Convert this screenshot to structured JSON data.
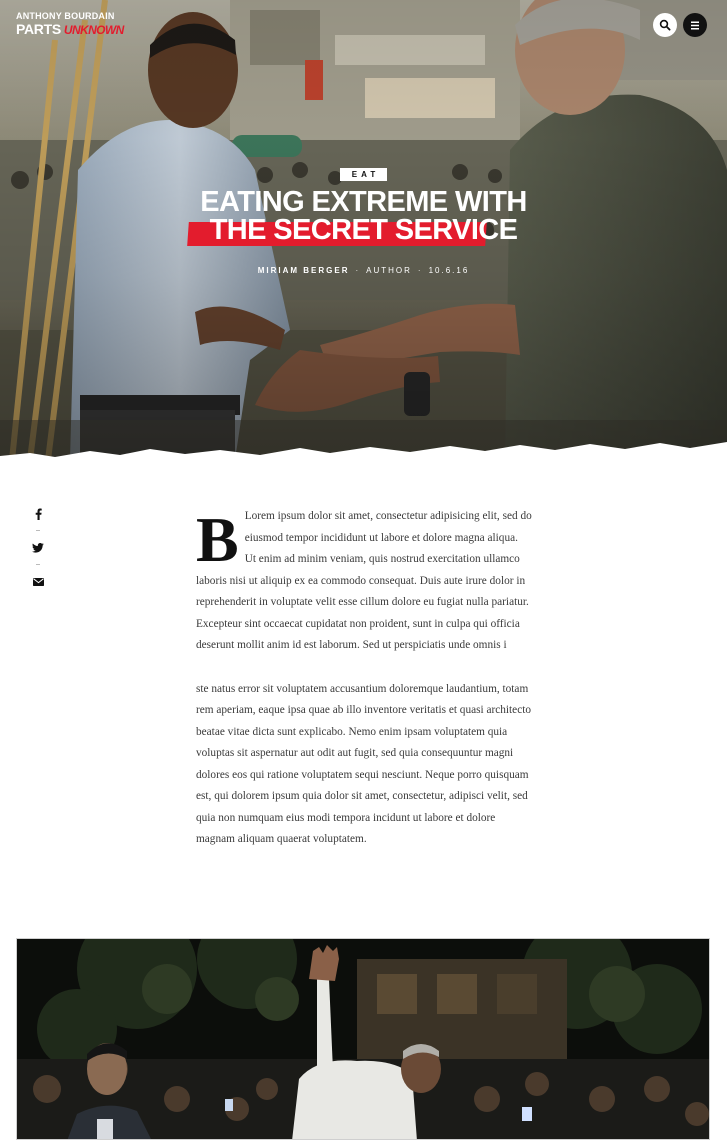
{
  "header": {
    "logo_line1": "ANTHONY BOURDAIN",
    "logo_line2": "PARTS",
    "logo_line3": "UNKNOWN",
    "search_icon": "search-icon",
    "menu_icon": "hamburger-menu-icon"
  },
  "hero": {
    "category": "EAT",
    "title_line1": "EATING EXTREME WITH",
    "title_line2": "THE SECRET SERVICE",
    "author_name": "MIRIAM BERGER",
    "separator": "·",
    "author_role": "AUTHOR",
    "date": "10.6.16"
  },
  "share": {
    "icons": [
      "facebook-icon",
      "twitter-icon",
      "email-icon"
    ]
  },
  "article": {
    "dropcap": "B",
    "p1": "Lorem ipsum dolor sit amet, consectetur adipisicing elit, sed do eiusmod tempor incididunt ut labore et dolore magna aliqua. Ut enim ad minim veniam, quis nostrud exercitation ullamco laboris nisi ut aliquip ex ea commodo consequat. Duis aute irure dolor in reprehenderit in voluptate velit esse cillum dolore eu fugiat nulla pariatur. Excepteur sint occaecat cupidatat non proident, sunt in culpa qui officia deserunt mollit anim id est laborum. Sed ut perspiciatis unde omnis i",
    "p2": "ste natus error sit voluptatem accusantium doloremque laudantium, totam rem aperiam, eaque ipsa quae ab illo inventore veritatis et quasi architecto beatae vitae dicta sunt explicabo. Nemo enim ipsam voluptatem quia voluptas sit aspernatur aut odit aut fugit, sed quia consequuntur magni dolores eos qui ratione voluptatem sequi nesciunt. Neque porro quisquam est, qui dolorem ipsum quia dolor sit amet, consectetur, adipisci velit, sed quia non numquam eius modi tempora incidunt ut labore et dolore magnam aliquam quaerat voluptatem."
  },
  "colors": {
    "brand_red": "#e31c2d",
    "text": "#3a3a3a",
    "dark": "#111111"
  }
}
